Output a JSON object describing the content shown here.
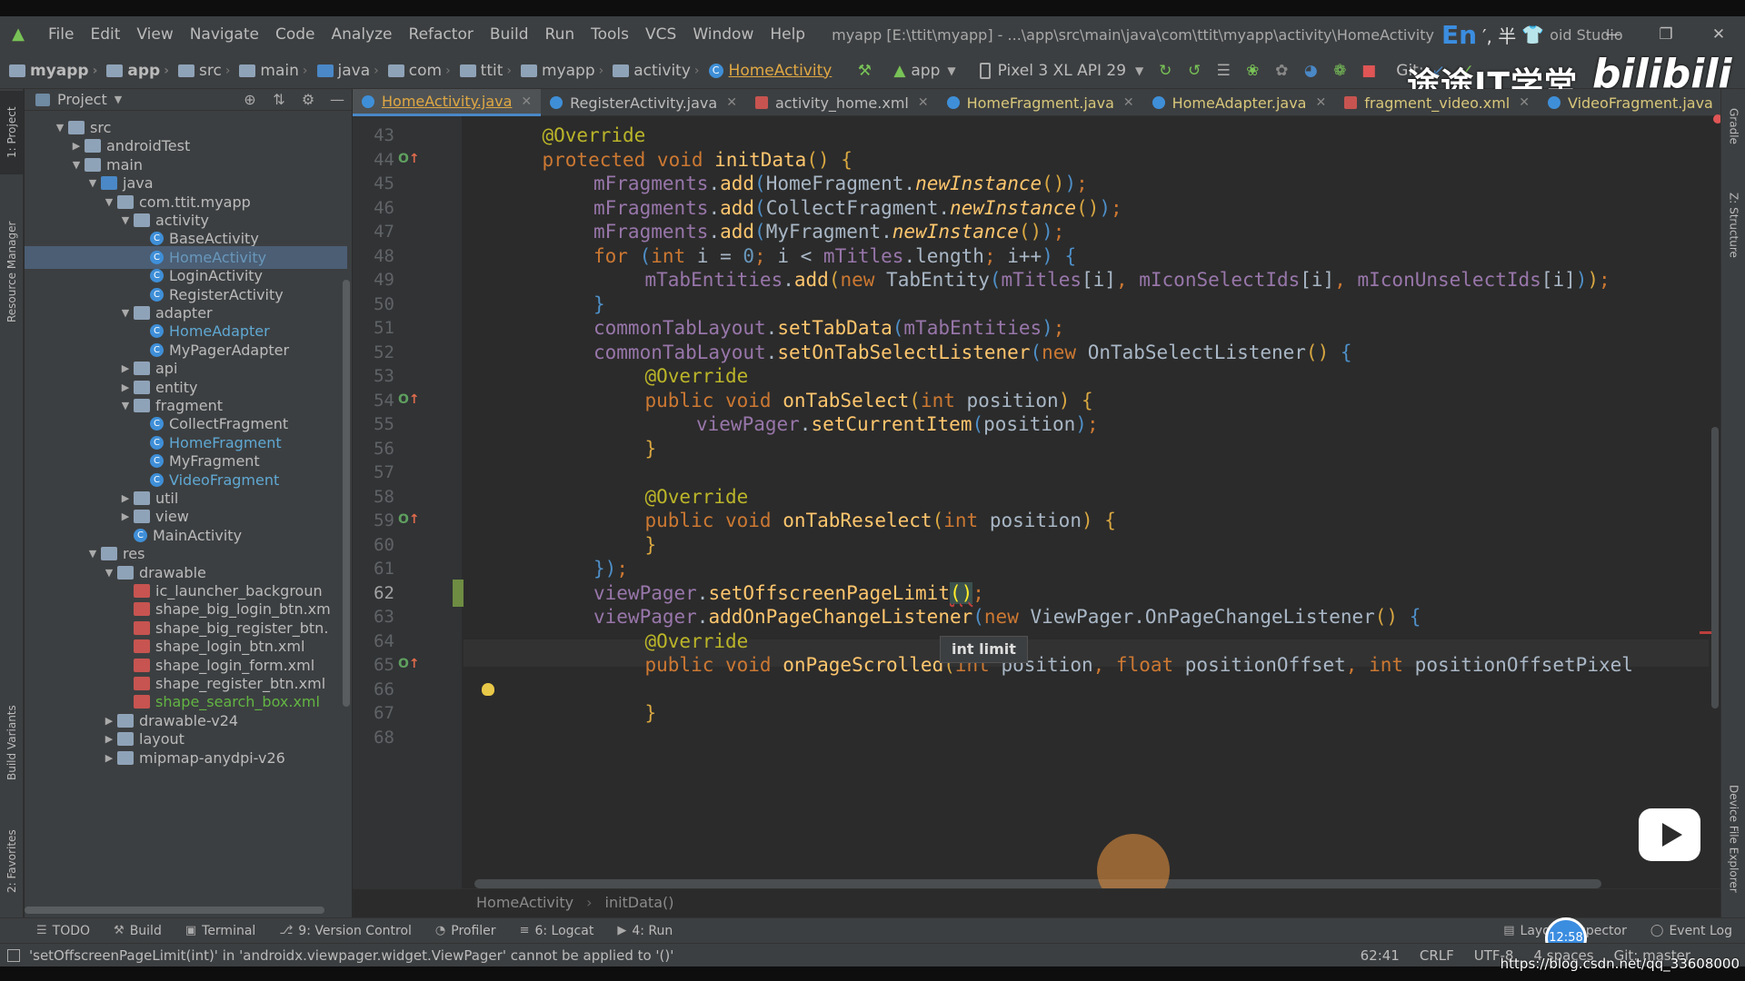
{
  "menubar": {
    "items": [
      "File",
      "Edit",
      "View",
      "Navigate",
      "Code",
      "Analyze",
      "Refactor",
      "Build",
      "Run",
      "Tools",
      "VCS",
      "Window",
      "Help"
    ],
    "window_title": "myapp [E:\\ttit\\myapp] - ...\\app\\src\\main\\java\\com\\ttit\\myapp\\activity\\HomeActivity",
    "ime_label": "En",
    "ime_extra": "′, 半",
    "title_suffix": "oid Studio",
    "window_controls": {
      "minimize": "—",
      "restore": "❐",
      "close": "✕"
    }
  },
  "navbar": {
    "breadcrumbs": [
      "myapp",
      "app",
      "src",
      "main",
      "java",
      "com",
      "ttit",
      "myapp",
      "activity"
    ],
    "current_class": "HomeActivity",
    "run_config": "app",
    "device": "Pixel 3 XL API 29",
    "git_label": "Git:",
    "icons": [
      "hammer-icon",
      "rerun-icon",
      "apply-changes-icon",
      "coverage-icon",
      "debug-icon",
      "attach-debugger-icon",
      "profile-icon",
      "android-debug-icon",
      "stop-icon"
    ]
  },
  "watermark": {
    "text": "途途IT学堂",
    "bili": "bilibili",
    "url": "https://blog.csdn.net/qq_33608000"
  },
  "left_strip": {
    "tabs": [
      "1: Project",
      "Resource Manager",
      "Build Variants",
      "2: Favorites"
    ]
  },
  "right_strip": {
    "tabs": [
      "Gradle",
      "Z: Structure",
      "Device File Explorer"
    ]
  },
  "project_panel": {
    "title": "Project",
    "tree": [
      {
        "label": "src",
        "depth": 0,
        "arrow": "▼",
        "icon": "folder",
        "color": ""
      },
      {
        "label": "androidTest",
        "depth": 1,
        "arrow": "▶",
        "icon": "folder",
        "color": ""
      },
      {
        "label": "main",
        "depth": 1,
        "arrow": "▼",
        "icon": "folder",
        "color": ""
      },
      {
        "label": "java",
        "depth": 2,
        "arrow": "▼",
        "icon": "folder-blue",
        "color": ""
      },
      {
        "label": "com.ttit.myapp",
        "depth": 3,
        "arrow": "▼",
        "icon": "package",
        "color": ""
      },
      {
        "label": "activity",
        "depth": 4,
        "arrow": "▼",
        "icon": "package",
        "color": ""
      },
      {
        "label": "BaseActivity",
        "depth": 5,
        "arrow": "",
        "icon": "class",
        "color": ""
      },
      {
        "label": "HomeActivity",
        "depth": 5,
        "arrow": "",
        "icon": "class",
        "color": "blue",
        "selected": true
      },
      {
        "label": "LoginActivity",
        "depth": 5,
        "arrow": "",
        "icon": "class",
        "color": ""
      },
      {
        "label": "RegisterActivity",
        "depth": 5,
        "arrow": "",
        "icon": "class",
        "color": ""
      },
      {
        "label": "adapter",
        "depth": 4,
        "arrow": "▼",
        "icon": "package",
        "color": ""
      },
      {
        "label": "HomeAdapter",
        "depth": 5,
        "arrow": "",
        "icon": "class",
        "color": "teal"
      },
      {
        "label": "MyPagerAdapter",
        "depth": 5,
        "arrow": "",
        "icon": "class",
        "color": ""
      },
      {
        "label": "api",
        "depth": 4,
        "arrow": "▶",
        "icon": "package",
        "color": ""
      },
      {
        "label": "entity",
        "depth": 4,
        "arrow": "▶",
        "icon": "package",
        "color": ""
      },
      {
        "label": "fragment",
        "depth": 4,
        "arrow": "▼",
        "icon": "package",
        "color": ""
      },
      {
        "label": "CollectFragment",
        "depth": 5,
        "arrow": "",
        "icon": "class",
        "color": ""
      },
      {
        "label": "HomeFragment",
        "depth": 5,
        "arrow": "",
        "icon": "class",
        "color": "teal"
      },
      {
        "label": "MyFragment",
        "depth": 5,
        "arrow": "",
        "icon": "class",
        "color": ""
      },
      {
        "label": "VideoFragment",
        "depth": 5,
        "arrow": "",
        "icon": "class",
        "color": "teal"
      },
      {
        "label": "util",
        "depth": 4,
        "arrow": "▶",
        "icon": "package",
        "color": ""
      },
      {
        "label": "view",
        "depth": 4,
        "arrow": "▶",
        "icon": "package",
        "color": ""
      },
      {
        "label": "MainActivity",
        "depth": 4,
        "arrow": "",
        "icon": "class",
        "color": ""
      },
      {
        "label": "res",
        "depth": 2,
        "arrow": "▼",
        "icon": "folder",
        "color": ""
      },
      {
        "label": "drawable",
        "depth": 3,
        "arrow": "▼",
        "icon": "folder",
        "color": ""
      },
      {
        "label": "ic_launcher_backgroun",
        "depth": 4,
        "arrow": "",
        "icon": "xml",
        "color": ""
      },
      {
        "label": "shape_big_login_btn.xm",
        "depth": 4,
        "arrow": "",
        "icon": "xml",
        "color": ""
      },
      {
        "label": "shape_big_register_btn.",
        "depth": 4,
        "arrow": "",
        "icon": "xml",
        "color": ""
      },
      {
        "label": "shape_login_btn.xml",
        "depth": 4,
        "arrow": "",
        "icon": "xml",
        "color": ""
      },
      {
        "label": "shape_login_form.xml",
        "depth": 4,
        "arrow": "",
        "icon": "xml",
        "color": ""
      },
      {
        "label": "shape_register_btn.xml",
        "depth": 4,
        "arrow": "",
        "icon": "xml",
        "color": ""
      },
      {
        "label": "shape_search_box.xml",
        "depth": 4,
        "arrow": "",
        "icon": "xml",
        "color": "green"
      },
      {
        "label": "drawable-v24",
        "depth": 3,
        "arrow": "▶",
        "icon": "folder",
        "color": ""
      },
      {
        "label": "layout",
        "depth": 3,
        "arrow": "▶",
        "icon": "folder",
        "color": ""
      },
      {
        "label": "mipmap-anydpi-v26",
        "depth": 3,
        "arrow": "▶",
        "icon": "folder",
        "color": ""
      }
    ]
  },
  "editor": {
    "tabs": [
      {
        "label": "HomeActivity.java",
        "type": "java",
        "style": "active"
      },
      {
        "label": "RegisterActivity.java",
        "type": "java",
        "style": "plain"
      },
      {
        "label": "activity_home.xml",
        "type": "xml",
        "style": "plain"
      },
      {
        "label": "HomeFragment.java",
        "type": "java",
        "style": "gold"
      },
      {
        "label": "HomeAdapter.java",
        "type": "java",
        "style": "gold"
      },
      {
        "label": "fragment_video.xml",
        "type": "xml",
        "style": "gold"
      },
      {
        "label": "VideoFragment.java",
        "type": "java",
        "style": "gold"
      }
    ],
    "lines": [
      {
        "num": "43",
        "indent": 1,
        "tokens": [
          [
            "a",
            "@Override"
          ]
        ]
      },
      {
        "num": "44",
        "indent": 1,
        "mark": "override",
        "tokens": [
          [
            "k",
            "protected void "
          ],
          [
            "m",
            "initData"
          ],
          [
            "br1",
            "()"
          ],
          [
            "p",
            " "
          ],
          [
            "br1",
            "{"
          ]
        ]
      },
      {
        "num": "45",
        "indent": 2,
        "tokens": [
          [
            "f",
            "mFragments"
          ],
          [
            "p",
            "."
          ],
          [
            "m",
            "add"
          ],
          [
            "br2",
            "("
          ],
          [
            "t",
            "HomeFragment."
          ],
          [
            "s",
            "newInstance"
          ],
          [
            "br1",
            "()"
          ],
          [
            "br2",
            ")"
          ],
          [
            "k",
            ";"
          ]
        ]
      },
      {
        "num": "46",
        "indent": 2,
        "tokens": [
          [
            "f",
            "mFragments"
          ],
          [
            "p",
            "."
          ],
          [
            "m",
            "add"
          ],
          [
            "br2",
            "("
          ],
          [
            "t",
            "CollectFragment."
          ],
          [
            "s",
            "newInstance"
          ],
          [
            "br1",
            "()"
          ],
          [
            "br2",
            ")"
          ],
          [
            "k",
            ";"
          ]
        ]
      },
      {
        "num": "47",
        "indent": 2,
        "tokens": [
          [
            "f",
            "mFragments"
          ],
          [
            "p",
            "."
          ],
          [
            "m",
            "add"
          ],
          [
            "br2",
            "("
          ],
          [
            "t",
            "MyFragment."
          ],
          [
            "s",
            "newInstance"
          ],
          [
            "br1",
            "()"
          ],
          [
            "br2",
            ")"
          ],
          [
            "k",
            ";"
          ]
        ]
      },
      {
        "num": "48",
        "indent": 2,
        "tokens": [
          [
            "k",
            "for "
          ],
          [
            "br2",
            "("
          ],
          [
            "k",
            "int "
          ],
          [
            "t",
            "i = "
          ],
          [
            "n",
            "0"
          ],
          [
            "k",
            "; "
          ],
          [
            "t",
            "i < "
          ],
          [
            "f",
            "mTitles"
          ],
          [
            "t",
            ".length"
          ],
          [
            "k",
            "; "
          ],
          [
            "t",
            "i++"
          ],
          [
            "br2",
            ")"
          ],
          [
            "p",
            " "
          ],
          [
            "br2",
            "{"
          ]
        ]
      },
      {
        "num": "49",
        "indent": 3,
        "tokens": [
          [
            "f",
            "mTabEntities"
          ],
          [
            "p",
            "."
          ],
          [
            "m",
            "add"
          ],
          [
            "br1",
            "("
          ],
          [
            "k",
            "new "
          ],
          [
            "t",
            "TabEntity"
          ],
          [
            "br2",
            "("
          ],
          [
            "f",
            "mTitles"
          ],
          [
            "t",
            "[i]"
          ],
          [
            "k",
            ", "
          ],
          [
            "f",
            "mIconSelectIds"
          ],
          [
            "t",
            "[i]"
          ],
          [
            "k",
            ", "
          ],
          [
            "f",
            "mIconUnselectIds"
          ],
          [
            "t",
            "[i]"
          ],
          [
            "br2",
            ")"
          ],
          [
            "br1",
            ")"
          ],
          [
            "k",
            ";"
          ]
        ]
      },
      {
        "num": "50",
        "indent": 2,
        "tokens": [
          [
            "br2",
            "}"
          ]
        ]
      },
      {
        "num": "51",
        "indent": 2,
        "tokens": [
          [
            "f",
            "commonTabLayout"
          ],
          [
            "p",
            "."
          ],
          [
            "m",
            "setTabData"
          ],
          [
            "br2",
            "("
          ],
          [
            "f",
            "mTabEntities"
          ],
          [
            "br2",
            ")"
          ],
          [
            "k",
            ";"
          ]
        ]
      },
      {
        "num": "52",
        "indent": 2,
        "tokens": [
          [
            "f",
            "commonTabLayout"
          ],
          [
            "p",
            "."
          ],
          [
            "m",
            "setOnTabSelectListener"
          ],
          [
            "br2",
            "("
          ],
          [
            "k",
            "new "
          ],
          [
            "t",
            "OnTabSelectListener"
          ],
          [
            "br1",
            "()"
          ],
          [
            "p",
            " "
          ],
          [
            "br2",
            "{"
          ]
        ]
      },
      {
        "num": "53",
        "indent": 3,
        "tokens": [
          [
            "a",
            "@Override"
          ]
        ]
      },
      {
        "num": "54",
        "indent": 3,
        "mark": "override",
        "tokens": [
          [
            "k",
            "public void "
          ],
          [
            "m",
            "onTabSelect"
          ],
          [
            "br1",
            "("
          ],
          [
            "k",
            "int "
          ],
          [
            "t",
            "position"
          ],
          [
            "br1",
            ")"
          ],
          [
            "p",
            " "
          ],
          [
            "br1",
            "{"
          ]
        ]
      },
      {
        "num": "55",
        "indent": 4,
        "tokens": [
          [
            "f",
            "viewPager"
          ],
          [
            "p",
            "."
          ],
          [
            "m",
            "setCurrentItem"
          ],
          [
            "br2",
            "("
          ],
          [
            "t",
            "position"
          ],
          [
            "br2",
            ")"
          ],
          [
            "k",
            ";"
          ]
        ]
      },
      {
        "num": "56",
        "indent": 3,
        "tokens": [
          [
            "br1",
            "}"
          ]
        ]
      },
      {
        "num": "57",
        "indent": 0,
        "tokens": []
      },
      {
        "num": "58",
        "indent": 3,
        "tokens": [
          [
            "a",
            "@Override"
          ]
        ]
      },
      {
        "num": "59",
        "indent": 3,
        "mark": "override",
        "tokens": [
          [
            "k",
            "public void "
          ],
          [
            "m",
            "onTabReselect"
          ],
          [
            "br1",
            "("
          ],
          [
            "k",
            "int "
          ],
          [
            "t",
            "position"
          ],
          [
            "br1",
            ")"
          ],
          [
            "p",
            " "
          ],
          [
            "br1",
            "{"
          ]
        ]
      },
      {
        "num": "60",
        "indent": 3,
        "tokens": [
          [
            "br1",
            "}"
          ]
        ]
      },
      {
        "num": "61",
        "indent": 2,
        "tokens": [
          [
            "br2",
            "}"
          ],
          [
            "br2",
            ")"
          ],
          [
            "k",
            ";"
          ]
        ]
      },
      {
        "num": "62",
        "indent": 2,
        "current": true,
        "tokens": [
          [
            "f",
            "viewPager"
          ],
          [
            "p",
            "."
          ],
          [
            "m",
            "setOffscreenPageLimit"
          ],
          [
            "err",
            "()"
          ],
          [
            "k",
            ";"
          ]
        ]
      },
      {
        "num": "63",
        "indent": 2,
        "tokens": [
          [
            "f",
            "viewPager"
          ],
          [
            "p",
            "."
          ],
          [
            "m",
            "addOnPageChangeListener"
          ],
          [
            "br2",
            "("
          ],
          [
            "k",
            "new "
          ],
          [
            "t",
            "ViewPager.OnPageChangeListener"
          ],
          [
            "br1",
            "()"
          ],
          [
            "p",
            " "
          ],
          [
            "br2",
            "{"
          ]
        ]
      },
      {
        "num": "64",
        "indent": 3,
        "tokens": [
          [
            "a",
            "@Override"
          ]
        ]
      },
      {
        "num": "65",
        "indent": 3,
        "mark": "override",
        "tokens": [
          [
            "k",
            "public void "
          ],
          [
            "m",
            "onPageScrolled"
          ],
          [
            "br1",
            "("
          ],
          [
            "k",
            "int "
          ],
          [
            "t",
            "position"
          ],
          [
            "k",
            ", "
          ],
          [
            "k",
            "float "
          ],
          [
            "t",
            "positionOffset"
          ],
          [
            "k",
            ", "
          ],
          [
            "k",
            "int "
          ],
          [
            "t",
            "positionOffsetPixel"
          ]
        ]
      },
      {
        "num": "66",
        "indent": 0,
        "tokens": []
      },
      {
        "num": "67",
        "indent": 3,
        "tokens": [
          [
            "br1",
            "}"
          ]
        ]
      },
      {
        "num": "68",
        "indent": 0,
        "tokens": []
      }
    ],
    "tooltip": "int limit",
    "breadcrumb": [
      "HomeActivity",
      "initData()"
    ]
  },
  "tool_windows": {
    "left": [
      {
        "icon": "☰",
        "label": "TODO"
      },
      {
        "icon": "⚒",
        "label": "Build"
      },
      {
        "icon": "▣",
        "label": "Terminal"
      },
      {
        "icon": "⎇",
        "label": "9: Version Control"
      },
      {
        "icon": "◔",
        "label": "Profiler"
      },
      {
        "icon": "≡",
        "label": "6: Logcat"
      },
      {
        "icon": "▶",
        "label": "4: Run"
      }
    ],
    "right": [
      {
        "icon": "▤",
        "label": "Layout Inspector"
      },
      {
        "icon": "◯",
        "label": "Event Log"
      }
    ]
  },
  "clock": "12:58",
  "statusbar": {
    "message": "'setOffscreenPageLimit(int)' in 'androidx.viewpager.widget.ViewPager' cannot be applied to '()'",
    "position": "62:41",
    "line_sep": "CRLF",
    "encoding": "UTF-8",
    "indent": "4 spaces",
    "git_branch": "Git: master"
  }
}
